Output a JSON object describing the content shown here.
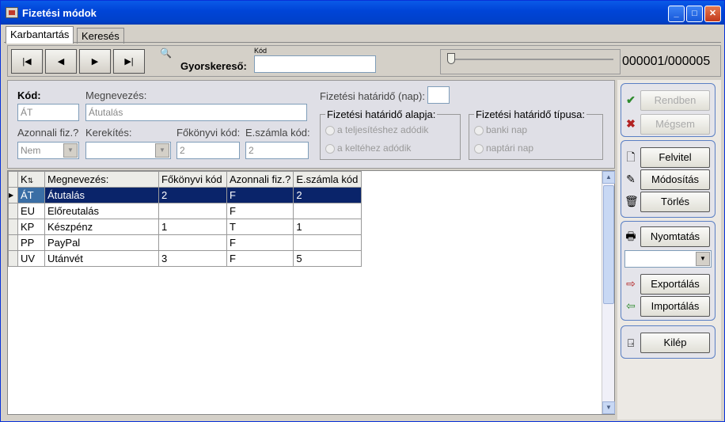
{
  "window": {
    "title": "Fizetési módok"
  },
  "tabs": [
    {
      "label": "Karbantartás",
      "active": true
    },
    {
      "label": "Keresés",
      "active": false
    }
  ],
  "nav": {
    "quicksearch_label": "Gyorskereső:",
    "quicksearch_caption": "Kód",
    "quicksearch_value": "",
    "record_counter": "000001/000005"
  },
  "form": {
    "kod_label": "Kód:",
    "kod_value": "ÁT",
    "megnevezes_label": "Megnevezés:",
    "megnevezes_value": "Átutalás",
    "azonnali_label": "Azonnali fiz.?",
    "azonnali_value": "Nem",
    "kerekites_label": "Kerekítés:",
    "kerekites_value": "",
    "fokonyvi_label": "Főkönyvi kód:",
    "fokonyvi_value": "2",
    "eszamla_label": "E.számla kód:",
    "eszamla_value": "2",
    "hatarido_label": "Fizetési határidő (nap):",
    "hatarido_value": "",
    "alapja_title": "Fizetési határidő alapja:",
    "alapja_options": [
      "a teljesítéshez adódik",
      "a keltéhez adódik"
    ],
    "tipusa_title": "Fizetési határidő típusa:",
    "tipusa_options": [
      "banki nap",
      "naptári nap"
    ]
  },
  "grid": {
    "columns": [
      "K",
      "Megnevezés:",
      "Főkönyvi kód",
      "Azonnali fiz.?",
      "E.számla kód"
    ],
    "rows": [
      [
        "ÁT",
        "Átutalás",
        "2",
        "F",
        "2"
      ],
      [
        "EU",
        "Előreutalás",
        "",
        "F",
        ""
      ],
      [
        "KP",
        "Készpénz",
        "1",
        "T",
        "1"
      ],
      [
        "PP",
        "PayPal",
        "",
        "F",
        ""
      ],
      [
        "UV",
        "Utánvét",
        "3",
        "F",
        "5"
      ]
    ],
    "selected_row": 0
  },
  "sidebar": {
    "ok_label": "Rendben",
    "cancel_label": "Mégsem",
    "new_label": "Felvitel",
    "edit_label": "Módosítás",
    "delete_label": "Törlés",
    "print_label": "Nyomtatás",
    "print_select_value": "",
    "export_label": "Exportálás",
    "import_label": "Importálás",
    "exit_label": "Kilép"
  },
  "colors": {
    "selection": "#0a246a",
    "titlebar": "#0045d8",
    "ok_check": "#2e8b2e",
    "cancel_x": "#b22222"
  }
}
